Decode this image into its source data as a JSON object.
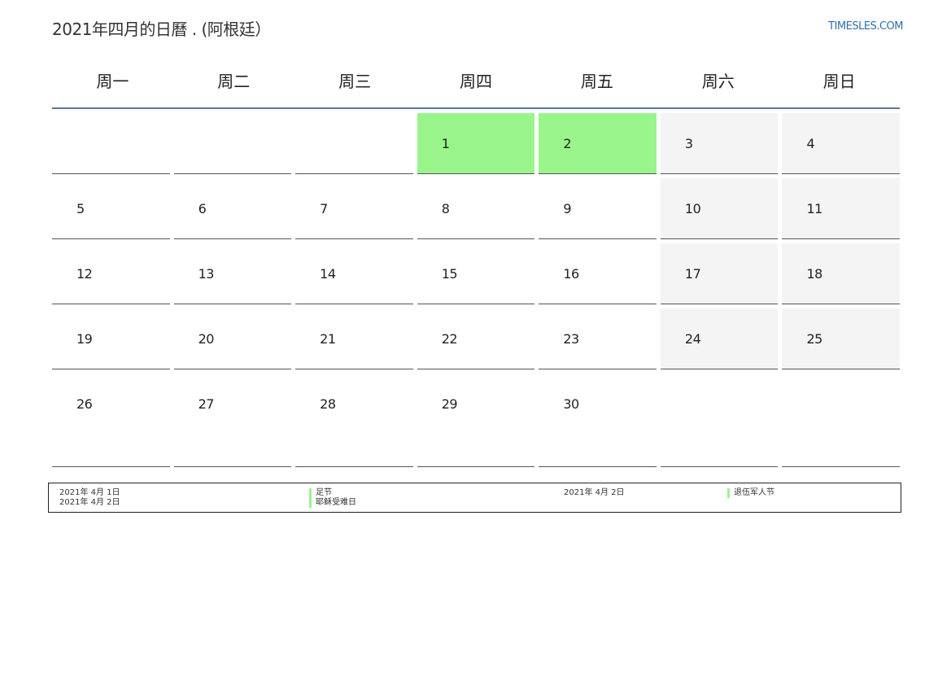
{
  "header": {
    "title": "2021年四月的日曆 . (阿根廷）",
    "brand": "TIMESLES.COM"
  },
  "colors": {
    "holiday": "#99f58a",
    "weekend": "#f4f4f4",
    "accent": "#5b7598",
    "brand": "#2f6fad"
  },
  "weekdays": [
    "周一",
    "周二",
    "周三",
    "周四",
    "周五",
    "周六",
    "周日"
  ],
  "weeks": [
    [
      "",
      "",
      "",
      "1",
      "2",
      "3",
      "4"
    ],
    [
      "5",
      "6",
      "7",
      "8",
      "9",
      "10",
      "11"
    ],
    [
      "12",
      "13",
      "14",
      "15",
      "16",
      "17",
      "18"
    ],
    [
      "19",
      "20",
      "21",
      "22",
      "23",
      "24",
      "25"
    ],
    [
      "26",
      "27",
      "28",
      "29",
      "30",
      "",
      ""
    ]
  ],
  "holidays": [
    {
      "date": "2021年 4月 1日",
      "name": "足节"
    },
    {
      "date": "2021年 4月 2日",
      "name": "耶稣受难日"
    },
    {
      "date": "2021年 4月 2日",
      "name": "退伍军人节"
    }
  ]
}
